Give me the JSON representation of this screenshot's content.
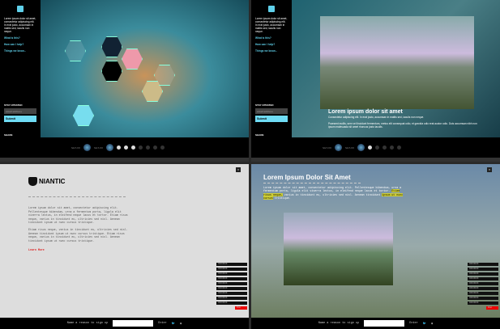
{
  "sidebar": {
    "intro": "Lorem ipsum dolor sit amet, consectetur adipiscing elit. In erat justo, accumsan in mattis sed, iaculis non neque.",
    "links": [
      "What is this?",
      "How can I help?",
      "Things we know..."
    ],
    "stay_updated": "STAY UPDATED",
    "email_placeholder": "email address",
    "submit": "Submit",
    "share": "SHARE"
  },
  "timeline": {
    "label_a": "SGT-XX",
    "label_b": "SGT-XX"
  },
  "caption": {
    "title": "Lorem ipsum dolor sit amet",
    "line1": "Consectetur adipiscing elit. In erat justo, accumsan in mattis sed, iaculis non neque.",
    "line2": "Praesent mollis, sem vel tincidunt fermentum, metus elit consequat odio, et gravida odio erat auctor odio. Duis accumsan nibh non ipsum malesuada sit amet rhoncus justo iaculis."
  },
  "niantic": {
    "brand": "NIANTIC",
    "p1": "Lorem ipsum dolor sit amet, consectetur adipiscing elit. Pellentesque bibendum, urna a fermentum porta, ligula elit viverra lectus, in eleifend neque lacus et tortor. Etiam risus neque, varius in tincidunt eu, ultricies sed nisl. Aenean tincidunt ipsum ut nunc cursus tristique.",
    "p2": "Etiam risus neque, varius in tincidunt eu, ultricies sed nisl. Aenean tincidunt ipsum ut nunc cursus tristique. Etiam risus neque, varius in tincidunt eu, ultricies sed nisl. Aenean tincidunt ipsum ut nunc cursus tristique.",
    "learn_more": "Learn More"
  },
  "panel4": {
    "title": "Lorem Ipsum Dolor Sit Amet",
    "text_a": "Lorem ipsum dolor sit amet, consectetur adipiscing elit. Pellentesque bibendum, urna a fermentum porta, ligula elit viverra lectus, in eleifend neque lacus et tortor. ",
    "highlight1": "Etiam risus neque,",
    "text_b": " varius in tincidunt eu, ultricies sed nisl. Aenean tincidunt ",
    "highlight2": "ipsum ut nunc cursus",
    "text_c": " tristique."
  },
  "stack_items": [
    "XX/XX/XX",
    "XX/XX/XX",
    "XX/XX/XX",
    "XX/XX/XX",
    "XX/XX/XX",
    "XX/XX/XX",
    "XX/XX/XX",
    "XX/XX/XX",
    "XX/XX/XX",
    "Post"
  ],
  "footer": {
    "prompt": "Name a reason to sign up",
    "enter": "Enter"
  },
  "close": "×"
}
